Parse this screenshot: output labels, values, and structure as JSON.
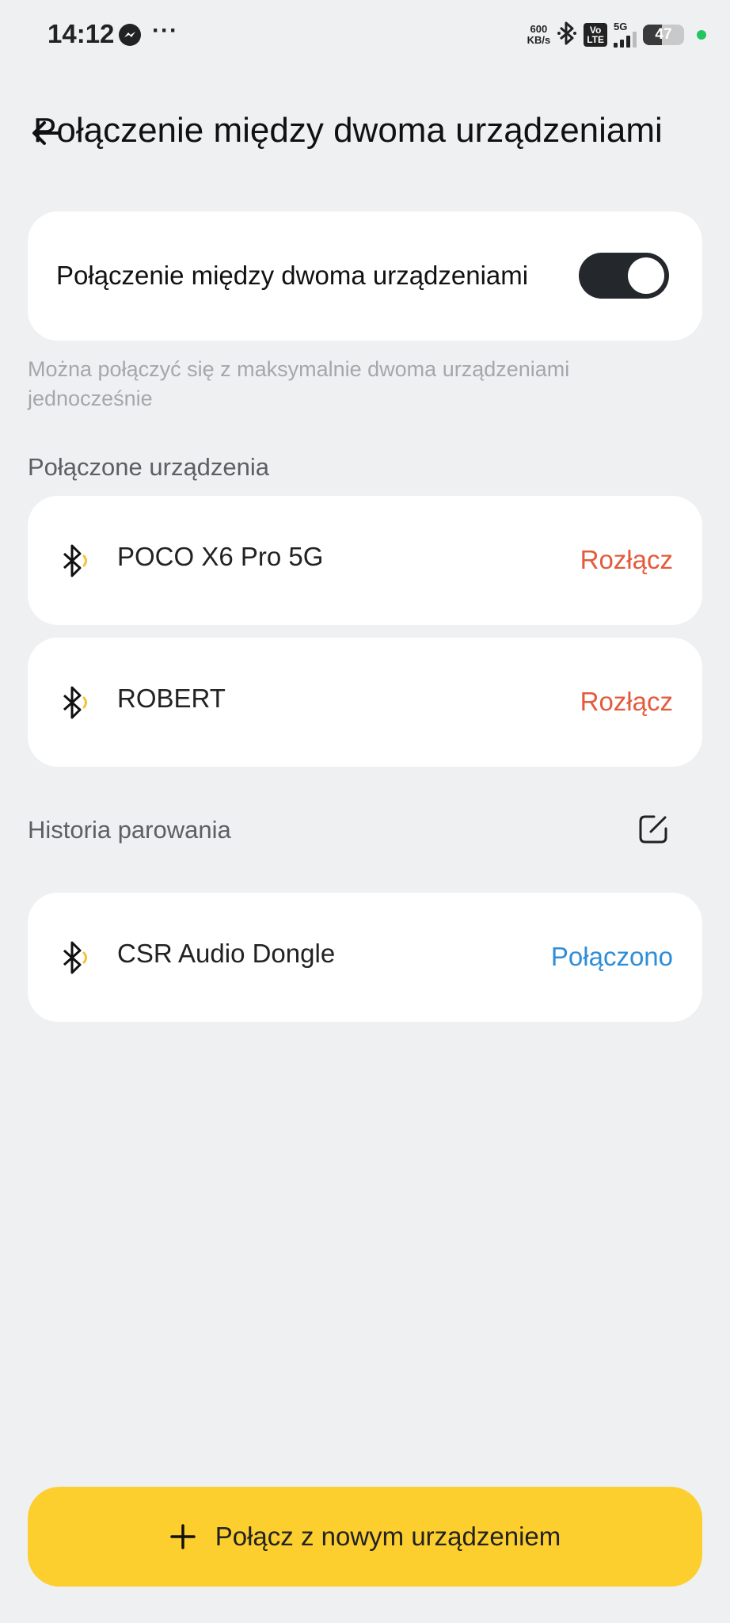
{
  "status_bar": {
    "time": "14:12",
    "dots": "···",
    "speed_value": "600",
    "speed_unit": "KB/s",
    "volte_top": "Vo",
    "volte_bottom": "LTE",
    "network": "5G",
    "battery": "47",
    "battery_level": 0.47,
    "messenger_icon": "messenger-icon",
    "bluetooth_icon": "bluetooth-icon"
  },
  "header": {
    "title": "Połączenie między dwoma urządzeniami",
    "back_icon": "back-arrow-icon"
  },
  "toggle_card": {
    "label": "Połączenie między dwoma urządzeniami",
    "enabled": true
  },
  "hint": "Można połączyć się z maksymalnie dwoma urządzeniami jednocześnie",
  "connected_section": {
    "label": "Połączone urządzenia",
    "devices": [
      {
        "name": "POCO X6 Pro 5G",
        "action": "Rozłącz"
      },
      {
        "name": "ROBERT",
        "action": "Rozłącz"
      }
    ]
  },
  "history_section": {
    "label": "Historia parowania",
    "edit_icon": "edit-icon",
    "devices": [
      {
        "name": "CSR Audio Dongle",
        "action": "Połączono"
      }
    ]
  },
  "add_button": {
    "label": "Połącz z nowym urządzeniem",
    "icon": "plus-icon"
  },
  "colors": {
    "background": "#eff0f2",
    "disconnect": "#e55a3c",
    "connected": "#2f8ed8",
    "accent": "#fdcf2e",
    "toggle_on": "#24282c",
    "bt_wave": "#f3c33c"
  }
}
